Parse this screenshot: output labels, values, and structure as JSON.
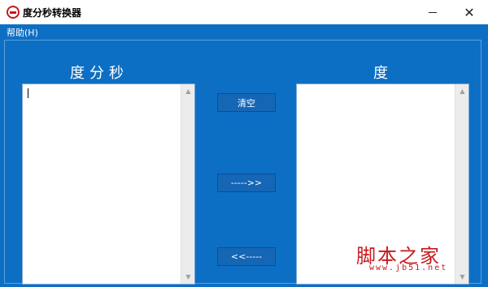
{
  "window": {
    "title": "度分秒转换器",
    "minimize_glyph": "—",
    "close_glyph": "✕"
  },
  "menu": {
    "help_label": "帮助(H)"
  },
  "panels": {
    "left_heading": "度分秒",
    "right_heading": "度",
    "left_value": "",
    "right_value": ""
  },
  "buttons": {
    "clear_label": "清空",
    "to_degrees_label": "----->>",
    "to_dms_label": "<<-----"
  },
  "scrollbar": {
    "up_glyph": "▲",
    "down_glyph": "▼"
  },
  "watermark": {
    "text": "脚本之家",
    "url": "www.jb51.net"
  },
  "colors": {
    "client_bg": "#0d6fc4",
    "button_bg": "#1566b5",
    "watermark": "#c8191e"
  },
  "icons": {
    "app": "app-logo-icon",
    "minimize": "minimize-icon",
    "close": "close-icon"
  }
}
